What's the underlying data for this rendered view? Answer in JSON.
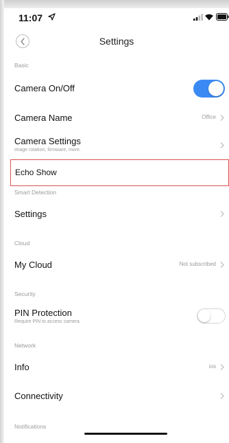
{
  "status": {
    "time": "11:07"
  },
  "nav": {
    "title": "Settings"
  },
  "sections": {
    "basic": "Basic",
    "smart_detection": "Smart Detection",
    "cloud": "Cloud",
    "security": "Security",
    "network": "Network",
    "notifications": "Notifications"
  },
  "rows": {
    "camera_onoff": {
      "label": "Camera On/Off",
      "on": true
    },
    "camera_name": {
      "label": "Camera Name",
      "value": "Office"
    },
    "camera_settings": {
      "label": "Camera Settings",
      "sub": "image rotation, firmware, more."
    },
    "echo_show": {
      "label": "Echo Show"
    },
    "settings": {
      "label": "Settings"
    },
    "my_cloud": {
      "label": "My Cloud",
      "value": "Not subscribed"
    },
    "pin_protection": {
      "label": "PIN Protection",
      "sub": "Require PIN to access camera",
      "on": false
    },
    "info": {
      "label": "Info",
      "value": "ios"
    },
    "connectivity": {
      "label": "Connectivity"
    }
  },
  "colors": {
    "toggle_on": "#3b8af4",
    "highlight": "#d9534f"
  }
}
